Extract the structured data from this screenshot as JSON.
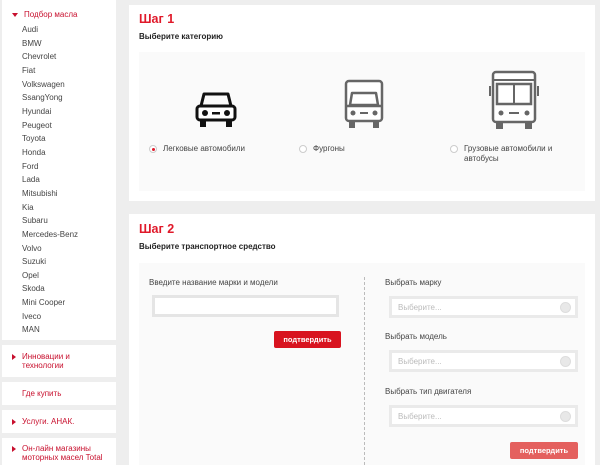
{
  "sidebar": {
    "oil_selection": "Подбор масла",
    "brands": [
      "Audi",
      "BMW",
      "Chevrolet",
      "Fiat",
      "Volkswagen",
      "SsangYong",
      "Hyundai",
      "Peugeot",
      "Toyota",
      "Honda",
      "Ford",
      "Lada",
      "Mitsubishi",
      "Kia",
      "Subaru",
      "Mercedes-Benz",
      "Volvo",
      "Suzuki",
      "Opel",
      "Skoda",
      "Mini Cooper",
      "Iveco",
      "MAN"
    ],
    "innovations": "Инновации и технологии",
    "where_to_buy": "Где купить",
    "services": "Услуги. АНАК.",
    "online_shops": "Он-лайн магазины моторных масел Total"
  },
  "step1": {
    "title": "Шаг 1",
    "subtitle": "Выберите категорию",
    "categories": [
      {
        "label": "Легковые автомобили",
        "icon": "car-icon",
        "selected": true
      },
      {
        "label": "Фургоны",
        "icon": "van-icon",
        "selected": false
      },
      {
        "label": "Грузовые автомобили и автобусы",
        "icon": "bus-icon",
        "selected": false
      }
    ]
  },
  "step2": {
    "title": "Шаг 2",
    "subtitle": "Выберите транспортное средство",
    "model_search_label": "Введите название марки и модели",
    "model_search_value": "",
    "confirm_label": "подтвердить",
    "brand_label": "Выбрать марку",
    "model_label": "Выбрать модель",
    "engine_label": "Выбрать тип двигателя",
    "select_placeholder": "Выберите..."
  },
  "colors": {
    "accent": "#e0192a",
    "button": "#d8131f",
    "button_disabled": "#e4605e",
    "background": "#eeeeee"
  }
}
